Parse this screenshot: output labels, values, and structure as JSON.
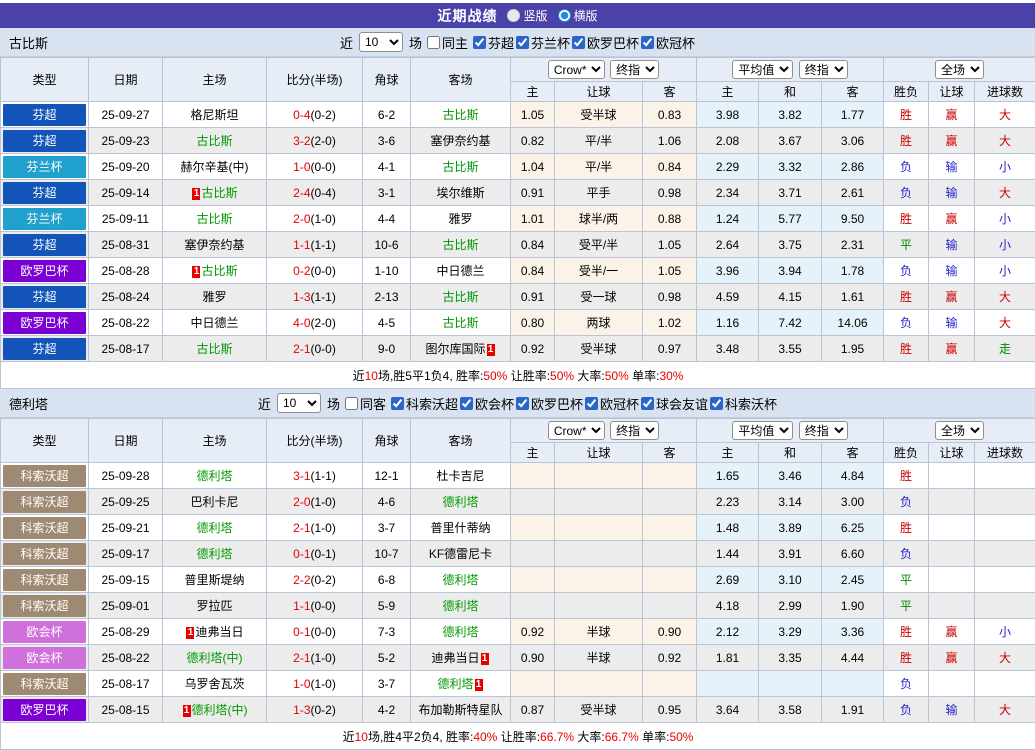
{
  "title_bar": {
    "title": "近期战绩",
    "radios": [
      {
        "label": "竖版",
        "checked": false
      },
      {
        "label": "横版",
        "checked": true
      }
    ]
  },
  "controls_labels": {
    "near": "近",
    "count": "10",
    "games": "场"
  },
  "header_labels": {
    "type": "类型",
    "date": "日期",
    "home": "主场",
    "score": "比分(半场)",
    "corners": "角球",
    "away": "客场",
    "odds_sub": [
      "主",
      "让球",
      "客"
    ],
    "avg_sub": [
      "主",
      "和",
      "客"
    ],
    "result_sub": [
      "胜负",
      "让球",
      "进球数"
    ],
    "selects": {
      "company": "Crow*",
      "final1": "终指",
      "average": "平均值",
      "final2": "终指",
      "scope": "全场"
    }
  },
  "colors": {
    "league": {
      "芬超": "#1254b8",
      "芬兰杯": "#20a0cc",
      "欧罗巴杯": "#7a00d4",
      "科索沃超": "#9e8a72",
      "欧会杯": "#d070dd"
    },
    "result": {
      "w": "#cc0000",
      "l": "#2323cc",
      "d": "#008800"
    },
    "team_green": "#009900",
    "score_red": "#e60000",
    "card_bg": "#e60000",
    "summary_red": "#e60000"
  },
  "sections": [
    {
      "team": "古比斯",
      "same_label": "同主",
      "same_checked": false,
      "leagues": [
        {
          "label": "芬超",
          "checked": true
        },
        {
          "label": "芬兰杯",
          "checked": true
        },
        {
          "label": "欧罗巴杯",
          "checked": true
        },
        {
          "label": "欧冠杯",
          "checked": true
        }
      ],
      "rows": [
        {
          "league": "芬超",
          "date": "25-09-27",
          "home": {
            "n": "格尼斯坦"
          },
          "score": "0-4",
          "half": "(0-2)",
          "corners": "6-2",
          "away": {
            "n": "古比斯",
            "g": 1
          },
          "odds": [
            "1.05",
            "受半球",
            "0.83"
          ],
          "avg": [
            "3.98",
            "3.82",
            "1.77"
          ],
          "res": [
            [
              "胜",
              "w"
            ],
            [
              "赢",
              "w"
            ],
            [
              "大",
              "w"
            ]
          ]
        },
        {
          "league": "芬超",
          "date": "25-09-23",
          "home": {
            "n": "古比斯",
            "g": 1
          },
          "score": "3-2",
          "half": "(2-0)",
          "corners": "3-6",
          "away": {
            "n": "塞伊奈约基"
          },
          "odds": [
            "0.82",
            "平/半",
            "1.06"
          ],
          "avg": [
            "2.08",
            "3.67",
            "3.06"
          ],
          "res": [
            [
              "胜",
              "w"
            ],
            [
              "赢",
              "w"
            ],
            [
              "大",
              "w"
            ]
          ]
        },
        {
          "league": "芬兰杯",
          "date": "25-09-20",
          "home": {
            "n": "赫尔辛基(中)"
          },
          "score": "1-0",
          "half": "(0-0)",
          "corners": "4-1",
          "away": {
            "n": "古比斯",
            "g": 1
          },
          "odds": [
            "1.04",
            "平/半",
            "0.84"
          ],
          "avg": [
            "2.29",
            "3.32",
            "2.86"
          ],
          "res": [
            [
              "负",
              "l"
            ],
            [
              "输",
              "l"
            ],
            [
              "小",
              "l"
            ]
          ]
        },
        {
          "league": "芬超",
          "date": "25-09-14",
          "home": {
            "n": "古比斯",
            "g": 1,
            "cb": "1"
          },
          "score": "2-4",
          "half": "(0-4)",
          "corners": "3-1",
          "away": {
            "n": "埃尔维斯"
          },
          "odds": [
            "0.91",
            "平手",
            "0.98"
          ],
          "avg": [
            "2.34",
            "3.71",
            "2.61"
          ],
          "res": [
            [
              "负",
              "l"
            ],
            [
              "输",
              "l"
            ],
            [
              "大",
              "w"
            ]
          ]
        },
        {
          "league": "芬兰杯",
          "date": "25-09-11",
          "home": {
            "n": "古比斯",
            "g": 1
          },
          "score": "2-0",
          "half": "(1-0)",
          "corners": "4-4",
          "away": {
            "n": "雅罗"
          },
          "odds": [
            "1.01",
            "球半/两",
            "0.88"
          ],
          "avg": [
            "1.24",
            "5.77",
            "9.50"
          ],
          "res": [
            [
              "胜",
              "w"
            ],
            [
              "赢",
              "w"
            ],
            [
              "小",
              "l"
            ]
          ]
        },
        {
          "league": "芬超",
          "date": "25-08-31",
          "home": {
            "n": "塞伊奈约基"
          },
          "score": "1-1",
          "half": "(1-1)",
          "corners": "10-6",
          "away": {
            "n": "古比斯",
            "g": 1
          },
          "odds": [
            "0.84",
            "受平/半",
            "1.05"
          ],
          "avg": [
            "2.64",
            "3.75",
            "2.31"
          ],
          "res": [
            [
              "平",
              "d"
            ],
            [
              "输",
              "l"
            ],
            [
              "小",
              "l"
            ]
          ]
        },
        {
          "league": "欧罗巴杯",
          "date": "25-08-28",
          "home": {
            "n": "古比斯",
            "g": 1,
            "cb": "1"
          },
          "score": "0-2",
          "half": "(0-0)",
          "corners": "1-10",
          "away": {
            "n": "中日德兰"
          },
          "odds": [
            "0.84",
            "受半/一",
            "1.05"
          ],
          "avg": [
            "3.96",
            "3.94",
            "1.78"
          ],
          "res": [
            [
              "负",
              "l"
            ],
            [
              "输",
              "l"
            ],
            [
              "小",
              "l"
            ]
          ]
        },
        {
          "league": "芬超",
          "date": "25-08-24",
          "home": {
            "n": "雅罗"
          },
          "score": "1-3",
          "half": "(1-1)",
          "corners": "2-13",
          "away": {
            "n": "古比斯",
            "g": 1
          },
          "odds": [
            "0.91",
            "受一球",
            "0.98"
          ],
          "avg": [
            "4.59",
            "4.15",
            "1.61"
          ],
          "res": [
            [
              "胜",
              "w"
            ],
            [
              "赢",
              "w"
            ],
            [
              "大",
              "w"
            ]
          ]
        },
        {
          "league": "欧罗巴杯",
          "date": "25-08-22",
          "home": {
            "n": "中日德兰"
          },
          "score": "4-0",
          "half": "(2-0)",
          "corners": "4-5",
          "away": {
            "n": "古比斯",
            "g": 1
          },
          "odds": [
            "0.80",
            "两球",
            "1.02"
          ],
          "avg": [
            "1.16",
            "7.42",
            "14.06"
          ],
          "res": [
            [
              "负",
              "l"
            ],
            [
              "输",
              "l"
            ],
            [
              "大",
              "w"
            ]
          ]
        },
        {
          "league": "芬超",
          "date": "25-08-17",
          "home": {
            "n": "古比斯",
            "g": 1
          },
          "score": "2-1",
          "half": "(0-0)",
          "corners": "9-0",
          "away": {
            "n": "图尔库国际",
            "ca": "1"
          },
          "odds": [
            "0.92",
            "受半球",
            "0.97"
          ],
          "avg": [
            "3.48",
            "3.55",
            "1.95"
          ],
          "res": [
            [
              "胜",
              "w"
            ],
            [
              "赢",
              "w"
            ],
            [
              "走",
              "d"
            ]
          ]
        }
      ],
      "summary": [
        {
          "t": "近"
        },
        {
          "t": "10",
          "r": 1
        },
        {
          "t": "场,胜5平1负4, 胜率:"
        },
        {
          "t": "50%",
          "r": 1
        },
        {
          "t": " 让胜率:"
        },
        {
          "t": "50%",
          "r": 1
        },
        {
          "t": " 大率:"
        },
        {
          "t": "50%",
          "r": 1
        },
        {
          "t": " 单率:"
        },
        {
          "t": "30%",
          "r": 1
        }
      ]
    },
    {
      "team": "德利塔",
      "same_label": "同客",
      "same_checked": false,
      "leagues": [
        {
          "label": "科索沃超",
          "checked": true
        },
        {
          "label": "欧会杯",
          "checked": true
        },
        {
          "label": "欧罗巴杯",
          "checked": true
        },
        {
          "label": "欧冠杯",
          "checked": true
        },
        {
          "label": "球会友谊",
          "checked": true
        },
        {
          "label": "科索沃杯",
          "checked": true
        }
      ],
      "rows": [
        {
          "league": "科索沃超",
          "date": "25-09-28",
          "home": {
            "n": "德利塔",
            "g": 1
          },
          "score": "3-1",
          "half": "(1-1)",
          "corners": "12-1",
          "away": {
            "n": "杜卡吉尼"
          },
          "odds": [
            "",
            "",
            ""
          ],
          "avg": [
            "1.65",
            "3.46",
            "4.84"
          ],
          "res": [
            [
              "胜",
              "w"
            ],
            [
              "",
              ""
            ],
            [
              "",
              ""
            ]
          ]
        },
        {
          "league": "科索沃超",
          "date": "25-09-25",
          "home": {
            "n": "巴利卡尼"
          },
          "score": "2-0",
          "half": "(1-0)",
          "corners": "4-6",
          "away": {
            "n": "德利塔",
            "g": 1
          },
          "odds": [
            "",
            "",
            ""
          ],
          "avg": [
            "2.23",
            "3.14",
            "3.00"
          ],
          "res": [
            [
              "负",
              "l"
            ],
            [
              "",
              ""
            ],
            [
              "",
              ""
            ]
          ]
        },
        {
          "league": "科索沃超",
          "date": "25-09-21",
          "home": {
            "n": "德利塔",
            "g": 1
          },
          "score": "2-1",
          "half": "(1-0)",
          "corners": "3-7",
          "away": {
            "n": "普里什蒂纳"
          },
          "odds": [
            "",
            "",
            ""
          ],
          "avg": [
            "1.48",
            "3.89",
            "6.25"
          ],
          "res": [
            [
              "胜",
              "w"
            ],
            [
              "",
              ""
            ],
            [
              "",
              ""
            ]
          ]
        },
        {
          "league": "科索沃超",
          "date": "25-09-17",
          "home": {
            "n": "德利塔",
            "g": 1
          },
          "score": "0-1",
          "half": "(0-1)",
          "corners": "10-7",
          "away": {
            "n": "KF德雷尼卡"
          },
          "odds": [
            "",
            "",
            ""
          ],
          "avg": [
            "1.44",
            "3.91",
            "6.60"
          ],
          "res": [
            [
              "负",
              "l"
            ],
            [
              "",
              ""
            ],
            [
              "",
              ""
            ]
          ]
        },
        {
          "league": "科索沃超",
          "date": "25-09-15",
          "home": {
            "n": "普里斯堤纳"
          },
          "score": "2-2",
          "half": "(0-2)",
          "corners": "6-8",
          "away": {
            "n": "德利塔",
            "g": 1
          },
          "odds": [
            "",
            "",
            ""
          ],
          "avg": [
            "2.69",
            "3.10",
            "2.45"
          ],
          "res": [
            [
              "平",
              "d"
            ],
            [
              "",
              ""
            ],
            [
              "",
              ""
            ]
          ]
        },
        {
          "league": "科索沃超",
          "date": "25-09-01",
          "home": {
            "n": "罗拉匹"
          },
          "score": "1-1",
          "half": "(0-0)",
          "corners": "5-9",
          "away": {
            "n": "德利塔",
            "g": 1
          },
          "odds": [
            "",
            "",
            ""
          ],
          "avg": [
            "4.18",
            "2.99",
            "1.90"
          ],
          "res": [
            [
              "平",
              "d"
            ],
            [
              "",
              ""
            ],
            [
              "",
              ""
            ]
          ]
        },
        {
          "league": "欧会杯",
          "date": "25-08-29",
          "home": {
            "n": "迪弗当日",
            "cb": "1"
          },
          "score": "0-1",
          "half": "(0-0)",
          "corners": "7-3",
          "away": {
            "n": "德利塔",
            "g": 1
          },
          "odds": [
            "0.92",
            "半球",
            "0.90"
          ],
          "avg": [
            "2.12",
            "3.29",
            "3.36"
          ],
          "res": [
            [
              "胜",
              "w"
            ],
            [
              "赢",
              "w"
            ],
            [
              "小",
              "l"
            ]
          ]
        },
        {
          "league": "欧会杯",
          "date": "25-08-22",
          "home": {
            "n": "德利塔(中)",
            "g": 1
          },
          "score": "2-1",
          "half": "(1-0)",
          "corners": "5-2",
          "away": {
            "n": "迪弗当日",
            "ca": "1"
          },
          "odds": [
            "0.90",
            "半球",
            "0.92"
          ],
          "avg": [
            "1.81",
            "3.35",
            "4.44"
          ],
          "res": [
            [
              "胜",
              "w"
            ],
            [
              "赢",
              "w"
            ],
            [
              "大",
              "w"
            ]
          ]
        },
        {
          "league": "科索沃超",
          "date": "25-08-17",
          "home": {
            "n": "乌罗舍瓦茨"
          },
          "score": "1-0",
          "half": "(1-0)",
          "corners": "3-7",
          "away": {
            "n": "德利塔",
            "g": 1,
            "ca": "1"
          },
          "odds": [
            "",
            "",
            ""
          ],
          "avg": [
            "",
            "",
            ""
          ],
          "res": [
            [
              "负",
              "l"
            ],
            [
              "",
              ""
            ],
            [
              "",
              ""
            ]
          ]
        },
        {
          "league": "欧罗巴杯",
          "date": "25-08-15",
          "home": {
            "n": "德利塔(中)",
            "g": 1,
            "cb": "1"
          },
          "score": "1-3",
          "half": "(0-2)",
          "corners": "4-2",
          "away": {
            "n": "布加勒斯特星队"
          },
          "odds": [
            "0.87",
            "受半球",
            "0.95"
          ],
          "avg": [
            "3.64",
            "3.58",
            "1.91"
          ],
          "res": [
            [
              "负",
              "l"
            ],
            [
              "输",
              "l"
            ],
            [
              "大",
              "w"
            ]
          ]
        }
      ],
      "summary": [
        {
          "t": "近"
        },
        {
          "t": "10",
          "r": 1
        },
        {
          "t": "场,胜4平2负4, 胜率:"
        },
        {
          "t": "40%",
          "r": 1
        },
        {
          "t": " 让胜率:"
        },
        {
          "t": "66.7%",
          "r": 1
        },
        {
          "t": " 大率:"
        },
        {
          "t": "66.7%",
          "r": 1
        },
        {
          "t": " 单率:"
        },
        {
          "t": "50%",
          "r": 1
        }
      ]
    }
  ]
}
